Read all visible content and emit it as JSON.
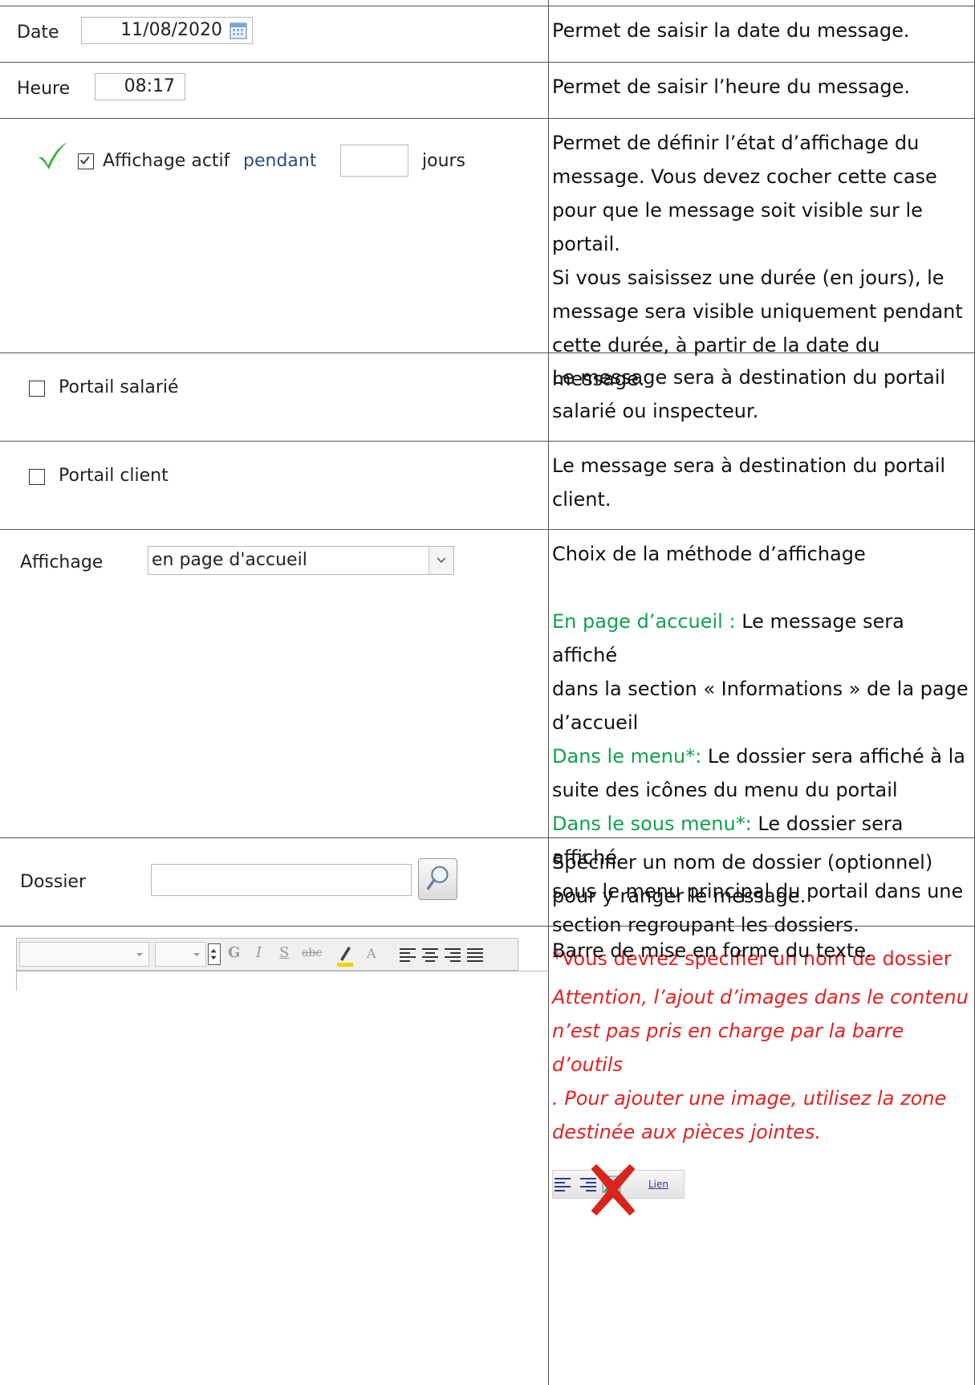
{
  "rows": [
    {
      "left": {
        "label": "Date",
        "value": "11/08/2020"
      },
      "right": "Permet de saisir la date du message."
    },
    {
      "left": {
        "label": "Heure",
        "value": "08:17"
      },
      "right": "Permet de saisir l’heure du message."
    },
    {
      "left": {
        "checkbox_label": "Affichage actif",
        "pendant": "pendant",
        "jours": "jours",
        "duration_value": ""
      },
      "right": [
        "Permet de définir l’état d’affichage du",
        "message. Vous devez cocher cette case",
        "pour que le message soit visible sur le",
        "portail.",
        "Si vous saisissez une durée (en jours), le",
        "message sera visible uniquement pendant",
        "cette durée, à partir de la date  du message."
      ]
    },
    {
      "left": {
        "checkbox_label": "Portail salarié"
      },
      "right": [
        "Le message sera à destination du portail",
        "salarié ou inspecteur."
      ]
    },
    {
      "left": {
        "checkbox_label": "Portail client"
      },
      "right": [
        "Le message sera à destination du portail",
        "client."
      ]
    },
    {
      "left": {
        "label": "Affichage",
        "select_value": "en page d'accueil"
      },
      "right": {
        "title": "Choix de la méthode d’affichage",
        "opt1_key": "En page d’accueil :",
        "opt1_text": " Le message sera affiché",
        "opt1_line2": "dans la section « Informations » de la page",
        "opt1_line3": "d’accueil",
        "opt2_key": "Dans le menu*:",
        "opt2_text": " Le dossier sera affiché à la",
        "opt2_line2": "suite des icônes du menu du portail",
        "opt3_key": "Dans le sous menu*:",
        "opt3_text": " Le dossier sera affiché",
        "opt3_line2": "sous le menu principal du portail dans une",
        "opt3_line3": "section regroupant les dossiers.",
        "note": "*Vous devrez spécifier un nom de dossier"
      }
    },
    {
      "left": {
        "label": "Dossier",
        "value": ""
      },
      "right": [
        "Spécifier un nom de dossier (optionnel)",
        "pour y ranger le message."
      ]
    },
    {
      "left": {
        "toolbar": {
          "bold": "G",
          "italic": "I",
          "underline": "S",
          "strike": "abc",
          "color": "A"
        }
      },
      "right": {
        "title": "Barre de mise en forme du texte.",
        "warning": [
          "Attention, l’ajout d’images dans le contenu",
          "n’est pas pris en charge par la barre d’outils",
          ". Pour ajouter une image, utilisez la zone",
          "destinée aux pièces jointes."
        ],
        "link_label": "Lien"
      }
    }
  ],
  "colors": {
    "green": "#11a150",
    "red": "#e32222",
    "border": "#555555"
  }
}
